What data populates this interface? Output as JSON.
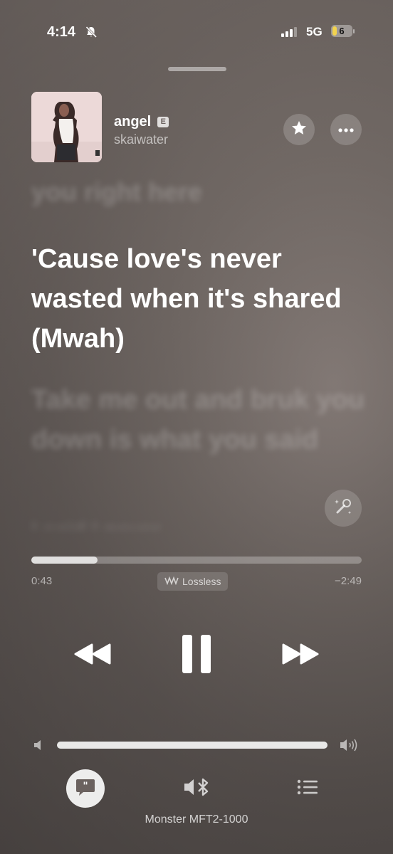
{
  "status_bar": {
    "time": "4:14",
    "network": "5G",
    "battery": "6"
  },
  "song": {
    "title": "angel",
    "explicit_badge": "E",
    "artist": "skaiwater"
  },
  "lyrics": {
    "previous": "you right here",
    "current": "'Cause love's never wasted when it's shared (Mwah)",
    "next": "Take me out and bruk you down is what you said",
    "next2": "I said I never ..."
  },
  "playback": {
    "elapsed": "0:43",
    "remaining": "−2:49",
    "quality_label": "Lossless",
    "progress_fraction": 0.2
  },
  "volume": {
    "level_fraction": 1.0
  },
  "output_device": "Monster MFT2-1000",
  "icons": {
    "bell": "bell-slash-icon",
    "star": "star-icon",
    "more": "ellipsis-icon",
    "sing": "microphone-sparkle-icon",
    "rewind": "rewind-icon",
    "pause": "pause-icon",
    "forward": "fast-forward-icon",
    "lyrics": "lyrics-quote-bubble-icon",
    "airplay": "speaker-bluetooth-icon",
    "queue": "queue-list-icon"
  },
  "colors": {
    "battery_fill": "#f2d34e",
    "background": "#6f6763"
  }
}
